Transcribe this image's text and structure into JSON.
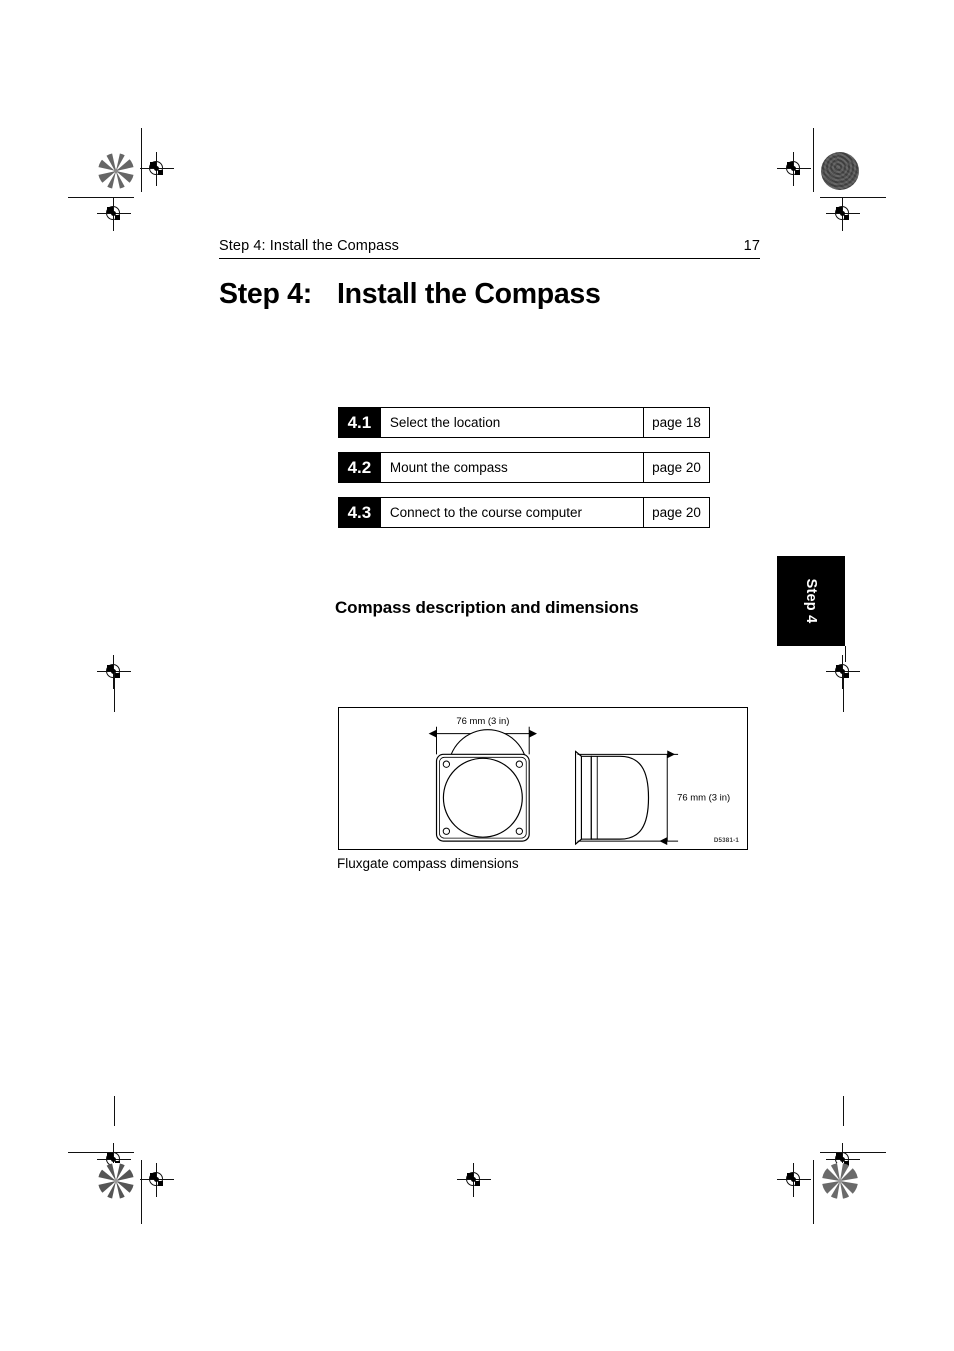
{
  "document": {
    "page_number": "17",
    "running_header": "Step 4: Install the Compass"
  },
  "chapter": {
    "number": "Step 4:",
    "title": "Install the Compass"
  },
  "section_index": {
    "rows": [
      {
        "number": "4.1",
        "label": "Select the location",
        "page_ref": "page 18"
      },
      {
        "number": "4.2",
        "label": "Mount the compass",
        "page_ref": "page 20"
      },
      {
        "number": "4.3",
        "label": "Connect to the course computer",
        "page_ref": "page 20"
      }
    ]
  },
  "section": {
    "heading": "Compass description and dimensions"
  },
  "thumb_tab": {
    "label": "Step 4"
  },
  "figure": {
    "caption": "Fluxgate compass dimensions",
    "drawing_code": "D5381-1",
    "dimension_width": "76 mm (3 in)",
    "dimension_height": "76 mm (3 in)"
  },
  "print_marks": {
    "registration_icon": "registration-target",
    "star_target_icon": "star-density-target",
    "density_patch_icon": "solid-density-patch"
  }
}
